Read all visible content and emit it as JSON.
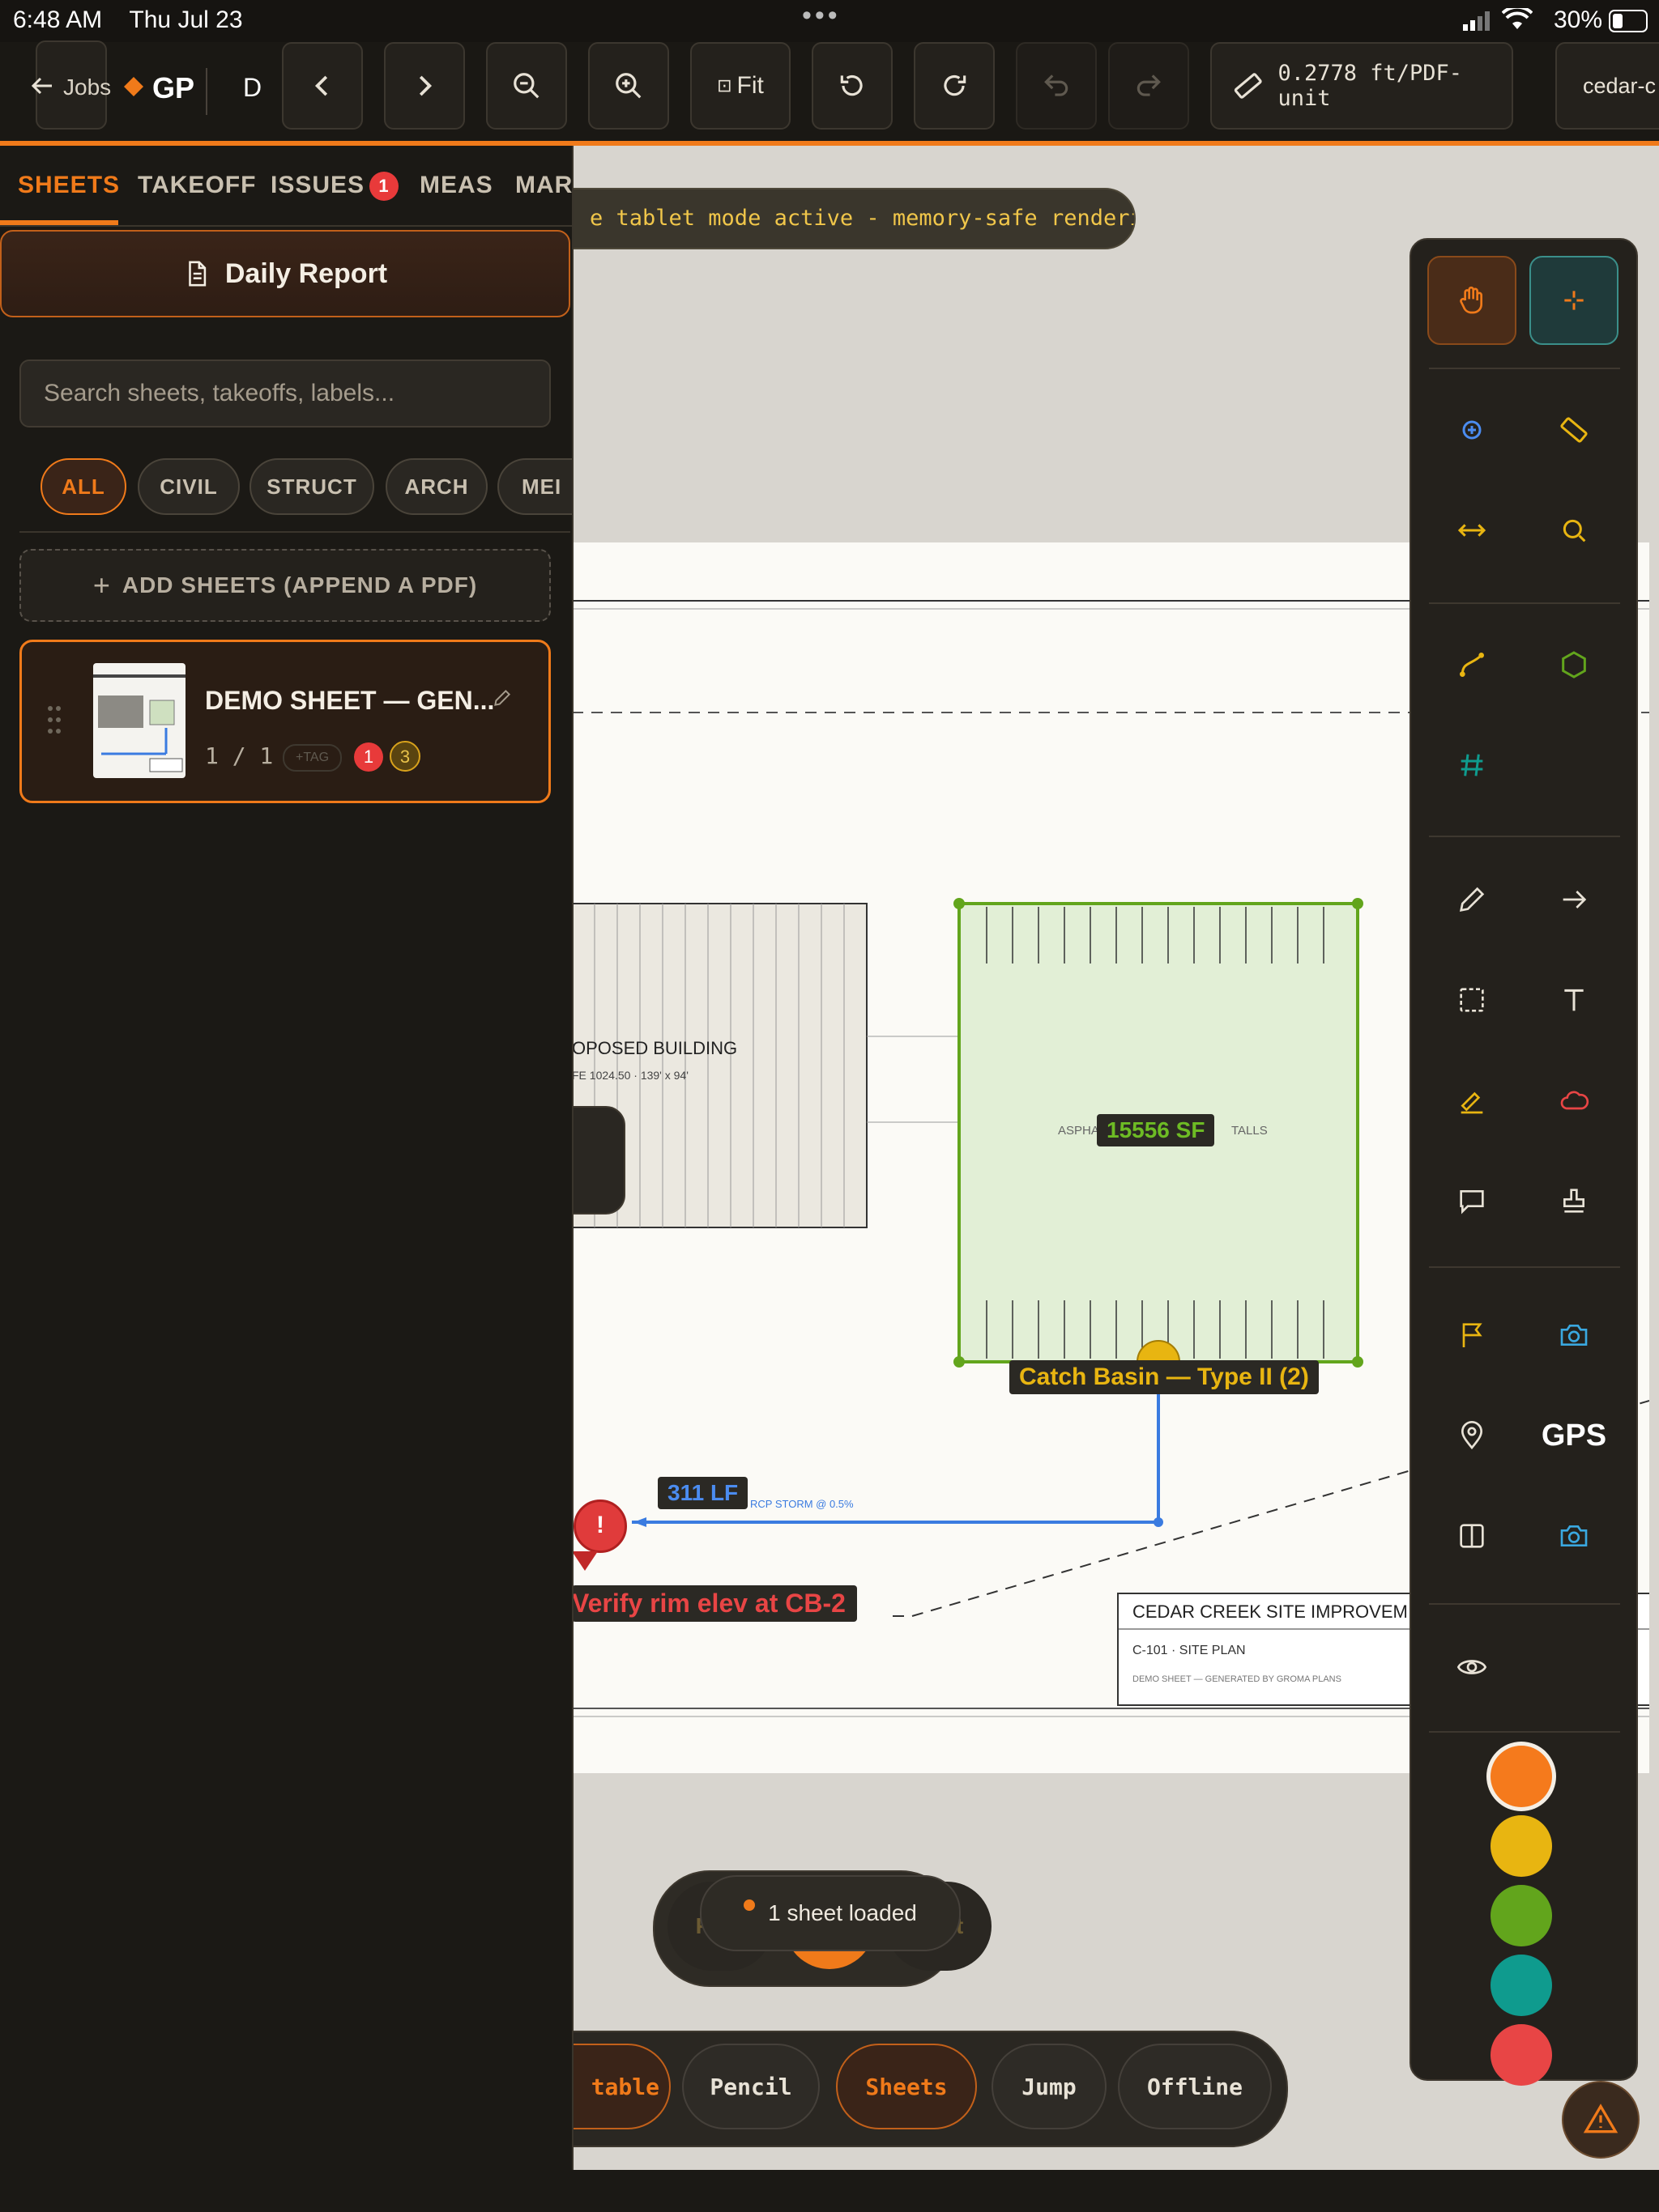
{
  "status": {
    "time": "6:48 AM",
    "date": "Thu Jul 23",
    "battery": "30%"
  },
  "toolbar": {
    "back_label": "Jobs",
    "brand": "GP",
    "d_label": "D",
    "fit_label": "Fit",
    "scale_label": "0.2778 ft/PDF-unit",
    "project_label": "cedar-c"
  },
  "banner": {
    "text": "e tablet mode active - memory-safe rendering"
  },
  "tabs": [
    {
      "label": "SHEETS"
    },
    {
      "label": "TAKEOFF"
    },
    {
      "label": "ISSUES",
      "badge": "1"
    },
    {
      "label": "MEAS"
    },
    {
      "label": "MARK"
    }
  ],
  "daily_report": {
    "label": "Daily Report"
  },
  "search": {
    "placeholder": "Search sheets, takeoffs, labels..."
  },
  "chips": [
    "ALL",
    "CIVIL",
    "STRUCT",
    "ARCH",
    "MEI"
  ],
  "add_sheets": {
    "label": "ADD SHEETS (APPEND A PDF)"
  },
  "sheet_card": {
    "title": "DEMO SHEET — GEN...",
    "pages": "1 / 1",
    "tag": "+TAG",
    "issues": "1",
    "markups": "3"
  },
  "drawing": {
    "building_title": "OPOSED BUILDING",
    "building_sub": "FE 1024.50   ·   139' x 94'",
    "lot_label": "ASPHA",
    "lot_label2": "TALLS",
    "area_label": "15556 SF",
    "catch_basin": "Catch Basin — Type II (2)",
    "length_label": "311 LF",
    "pipe_label": "RCP STORM @ 0.5%",
    "issue_text": "Verify rim elev at CB-2",
    "title_block_title": "CEDAR CREEK SITE IMPROVEM",
    "title_block_sheet": "C-101  ·  SITE PLAN",
    "title_block_note": "DEMO SHEET — GENERATED BY GROMA PLANS"
  },
  "tools": {
    "gps_label": "GPS"
  },
  "colors": {
    "accent": "#f07a1a",
    "swatches": [
      "#f57a1c",
      "#e8b511",
      "#62a51c",
      "#0f9b8e",
      "#e84545"
    ]
  },
  "pager": {
    "loaded": "1 sheet loaded",
    "prev": "Prev",
    "page": "1",
    "next": "Next"
  },
  "bottom_buttons": [
    "table",
    "Pencil",
    "Sheets",
    "Jump",
    "Offline"
  ]
}
